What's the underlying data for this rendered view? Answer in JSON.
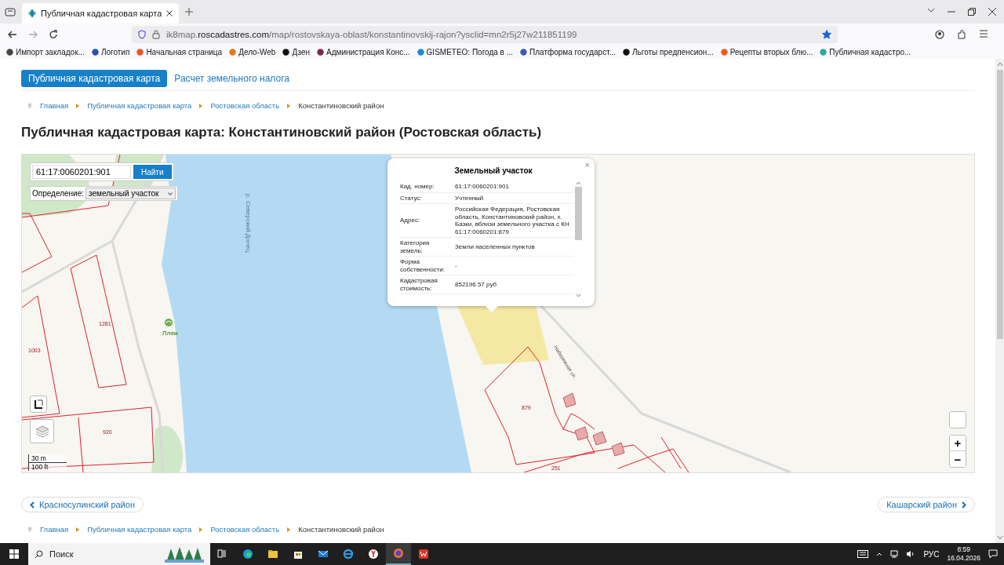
{
  "browser": {
    "tab_title": "Публичная кадастровая карта",
    "url": {
      "prefix": "ik8map.",
      "host": "roscadastres.com",
      "path": "/map/rostovskaya-oblast/konstantinovskij-rajon?ysclid=mn2r5j27w211851199"
    },
    "bookmarked": true,
    "bookmarks": [
      {
        "label": "Импорт закладок...",
        "color": "#444444"
      },
      {
        "label": "Логотип",
        "color": "#2a4fb0"
      },
      {
        "label": "Начальная страница",
        "color": "#e8532a"
      },
      {
        "label": "Дело-Web",
        "color": "#e07a1a"
      },
      {
        "label": "Дзен",
        "color": "#111111"
      },
      {
        "label": "Администрация Конс...",
        "color": "#7a2a50"
      },
      {
        "label": "GISMETEO: Погода в ...",
        "color": "#1e88d6"
      },
      {
        "label": "Платформа государст...",
        "color": "#3a5ab0"
      },
      {
        "label": "Льготы предпенсион...",
        "color": "#111111"
      },
      {
        "label": "Рецепты вторых блю...",
        "color": "#f05a1a"
      },
      {
        "label": "Публичная кадастро...",
        "color": "#2aa8a0"
      }
    ]
  },
  "site_tabs": [
    {
      "label": "Публичная кадастровая карта",
      "selected": true
    },
    {
      "label": "Расчет земельного налога",
      "selected": false
    }
  ],
  "breadcrumbs_top": [
    "Главная",
    "Публичная кадастровая карта",
    "Ростовская область",
    "Константиновский район"
  ],
  "title": "Публичная кадастровая карта: Константиновский район (Ростовская область)",
  "map": {
    "search_value": "61:17:0060201:901",
    "search_button": "Найти",
    "definition_label": "Определение:",
    "definition_value": "земельный участок",
    "labels": {
      "parcels": [
        "1281",
        "1003",
        "920",
        "879",
        "251"
      ],
      "beach": "Пляж",
      "river": "р. Северский Донец",
      "street": "Набережная ул."
    },
    "scale": [
      "30 m",
      "100 ft"
    ],
    "zoom_in": "+",
    "zoom_out": "−",
    "popup": {
      "title": "Земельный участок",
      "close": "×",
      "rows": [
        {
          "label": "Кад. номер:",
          "value": "61:17:0060201:901"
        },
        {
          "label": "Статус:",
          "value": "Учтенный"
        },
        {
          "label": "Адрес:",
          "value": "Российская Федерация, Ростовская область, Константиновский район, х. Базки, вблизи земельного участка с КН 61:17:0060201:879"
        },
        {
          "label": "Категория земель:",
          "value": "Земли населенных пунктов"
        },
        {
          "label": "Форма собственности:",
          "value": "-"
        },
        {
          "label": "Кадастровая стоимость:",
          "value": "852196.57 руб"
        }
      ]
    }
  },
  "pager": {
    "prev": "Красносулинский район",
    "next": "Кашарский район"
  },
  "breadcrumbs_bottom": [
    "Главная",
    "Публичная кадастровая карта",
    "Ростовская область",
    "Константиновский район"
  ],
  "taskbar": {
    "search": "Поиск",
    "language": "РУС",
    "time": "8:59",
    "date": "16.04.2026"
  }
}
